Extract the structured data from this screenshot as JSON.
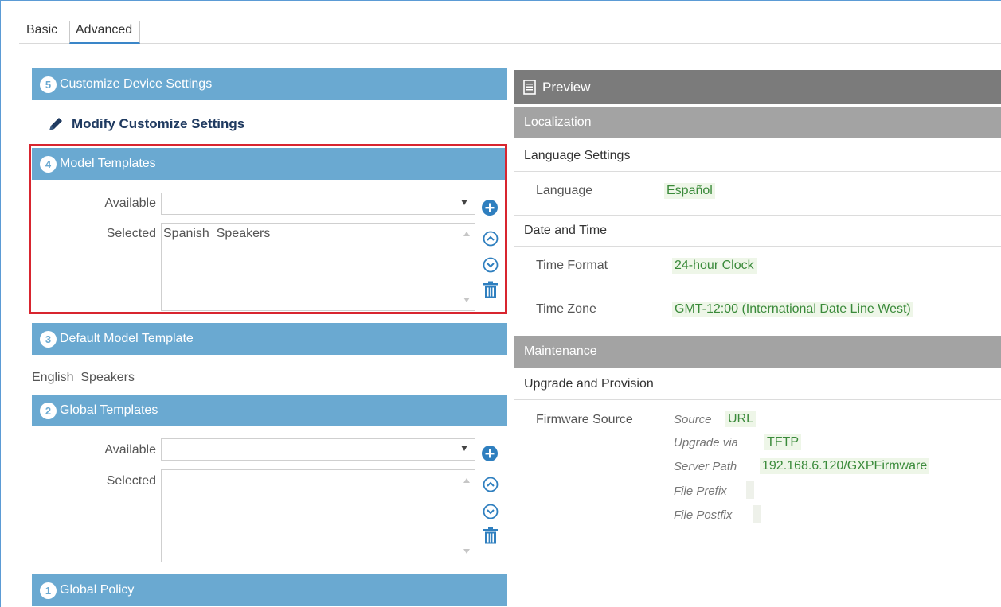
{
  "tabs": {
    "basic": "Basic",
    "advanced": "Advanced"
  },
  "left": {
    "section5": {
      "num": "5",
      "title": "Customize Device Settings"
    },
    "modify_link": "Modify Customize Settings",
    "section4": {
      "num": "4",
      "title": "Model Templates",
      "available_label": "Available",
      "available_value": "",
      "selected_label": "Selected",
      "selected_items": [
        "Spanish_Speakers"
      ]
    },
    "section3": {
      "num": "3",
      "title": "Default Model Template",
      "value": "English_Speakers"
    },
    "section2": {
      "num": "2",
      "title": "Global Templates",
      "available_label": "Available",
      "available_value": "",
      "selected_label": "Selected",
      "selected_items": []
    },
    "section1": {
      "num": "1",
      "title": "Global Policy"
    }
  },
  "preview": {
    "title": "Preview",
    "localization": {
      "header": "Localization",
      "language_settings": "Language Settings",
      "language_label": "Language",
      "language_value": "Español",
      "date_time": "Date and Time",
      "time_format_label": "Time Format",
      "time_format_value": "24-hour Clock",
      "time_zone_label": "Time Zone",
      "time_zone_value": "GMT-12:00 (International Date Line West)"
    },
    "maintenance": {
      "header": "Maintenance",
      "upgrade": "Upgrade and Provision",
      "firmware_source_label": "Firmware Source",
      "source_label": "Source",
      "source_value": "URL",
      "upgrade_via_label": "Upgrade via",
      "upgrade_via_value": "TFTP",
      "server_path_label": "Server Path",
      "server_path_value": "192.168.6.120/GXPFirmware",
      "file_prefix_label": "File Prefix",
      "file_postfix_label": "File Postfix"
    }
  },
  "colors": {
    "section_bar": "#6aa9d1",
    "highlight_border": "#d8252f",
    "preview_header": "#7b7b7b",
    "group_header": "#a3a3a3",
    "value_green": "#3a8a3a",
    "icon_blue": "#2f7fbf"
  }
}
